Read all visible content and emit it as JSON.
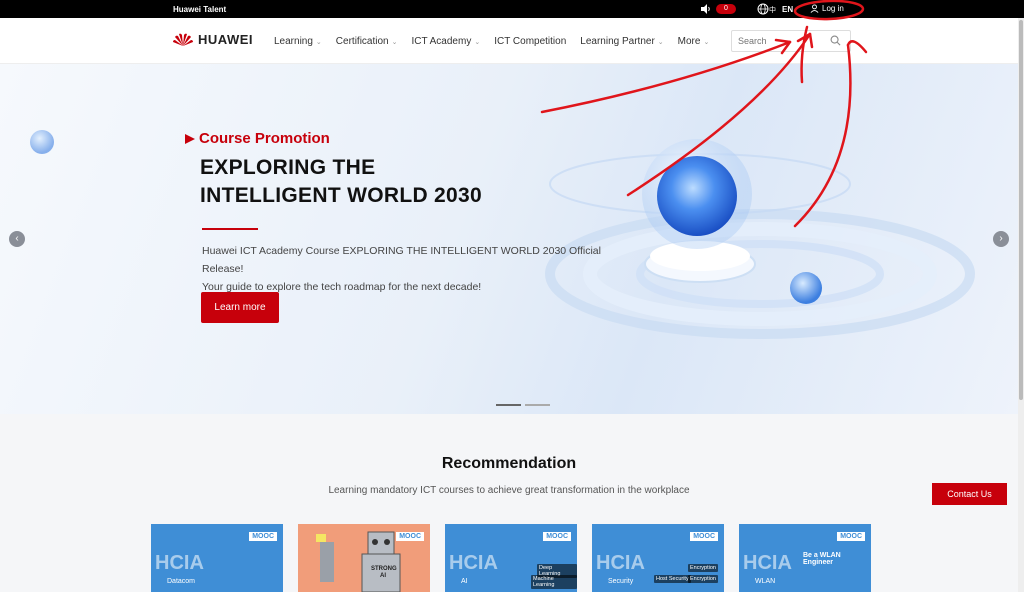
{
  "topbar": {
    "brand": "Huawei Talent",
    "badge": "0",
    "lang": "EN",
    "login_label": "Log in"
  },
  "nav": {
    "logo_text": "HUAWEI",
    "items": [
      "Learning",
      "Certification",
      "ICT Academy",
      "ICT Competition",
      "Learning Partner",
      "More"
    ],
    "search_placeholder": "Search"
  },
  "hero": {
    "tag": "Course Promotion",
    "title_line1": "EXPLORING THE",
    "title_line2": "INTELLIGENT WORLD 2030",
    "desc_line1": "Huawei ICT Academy Course EXPLORING THE INTELLIGENT WORLD 2030 Official Release!",
    "desc_line2": "Your guide to explore the tech roadmap for the next decade!",
    "cta": "Learn more"
  },
  "recommendation": {
    "title": "Recommendation",
    "subtitle": "Learning mandatory ICT courses to achieve great transformation in the workplace",
    "cards": [
      {
        "badge": "MOOC",
        "name": "HCIA",
        "sub": "Datacom"
      },
      {
        "badge": "MOOC",
        "name": "STRONG AI",
        "sub": ""
      },
      {
        "badge": "MOOC",
        "name": "HCIA",
        "sub": "AI",
        "tags": [
          "Deep Learning",
          "Machine Learning"
        ]
      },
      {
        "badge": "MOOC",
        "name": "HCIA",
        "sub": "Security",
        "tags": [
          "Encryption",
          "Host Security",
          "Encryption"
        ]
      },
      {
        "badge": "MOOC",
        "name": "HCIA",
        "sub": "WLAN",
        "headline": "Be a WLAN Engineer"
      }
    ]
  },
  "contact": "Contact Us",
  "colors": {
    "brand_red": "#c7000b",
    "card_blue": "#3f8ed6",
    "annotation_red": "#e0151b"
  }
}
